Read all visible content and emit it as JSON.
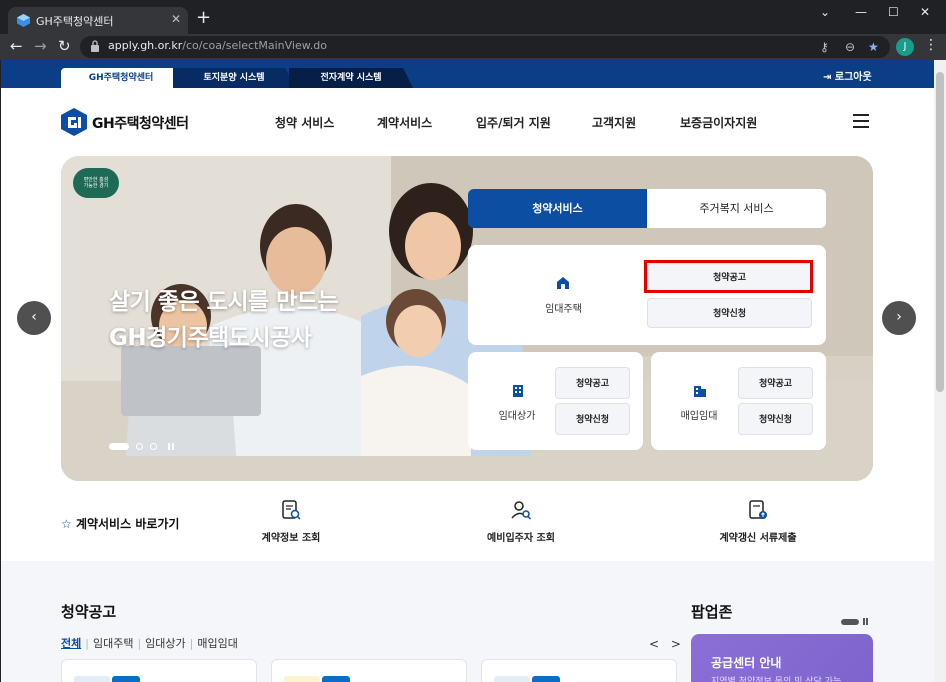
{
  "browser": {
    "tab_title": "GH주택청약센터",
    "tab_close": "✕",
    "new_tab": "+",
    "url_host": "apply.gh.or.kr",
    "url_path": "/co/coa/selectMainView.do",
    "profile_initial": "J"
  },
  "site_tabs": {
    "tab1": "GH주택청약센터",
    "tab2": "토지분양 시스템",
    "tab3": "전자계약 시스템",
    "logout": "로그아웃"
  },
  "header": {
    "logo_text": "GH주택청약센터",
    "nav": [
      "청약 서비스",
      "계약서비스",
      "입주/퇴거 지원",
      "고객지원",
      "보증금이자지원"
    ]
  },
  "hero": {
    "badge_line1": "편안한 홈섬",
    "badge_line2": "가능한 경기",
    "slogan_line1": "살기 좋은 도시를 만드는",
    "slogan_line2": "GH경기주택도시공사"
  },
  "service": {
    "tab_active": "청약서비스",
    "tab_other": "주거복지 서비스",
    "rental_house": {
      "label": "임대주택",
      "notice": "청약공고",
      "apply": "청약신청"
    },
    "rental_shop": {
      "label": "임대상가",
      "notice": "청약공고",
      "apply": "청약신청"
    },
    "purchase_rental": {
      "label": "매입임대",
      "notice": "청약공고",
      "apply": "청약신청"
    }
  },
  "quick": {
    "title": "계약서비스 바로가기",
    "items": [
      "계약정보 조회",
      "예비입주자 조회",
      "계약갱신 서류제출"
    ]
  },
  "notices": {
    "title": "청약공고",
    "filters": [
      "전체",
      "임대주택",
      "임대상가",
      "매입임대"
    ],
    "prev": "<",
    "next": ">"
  },
  "popup": {
    "title": "팝업존",
    "card_title": "공급센터 안내",
    "card_sub": "지역별 청약정보 문의 및 상담 가능"
  },
  "colors": {
    "brand_blue": "#0b4ea2",
    "site_bar": "#0b3e87",
    "highlight": "#e00000",
    "popup_purple": "#8b6fd6"
  }
}
